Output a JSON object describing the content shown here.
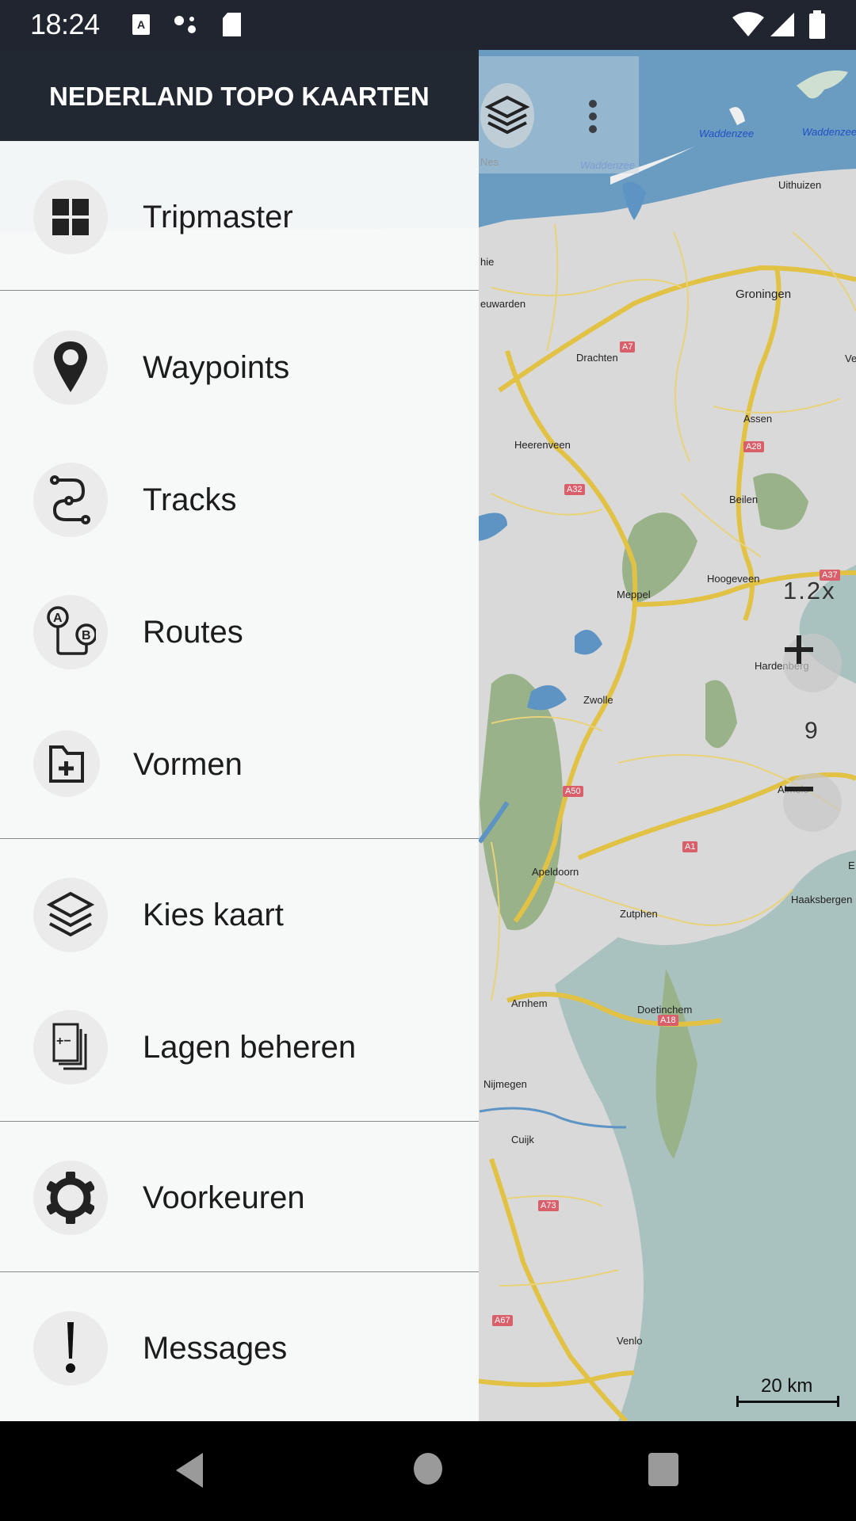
{
  "status_bar": {
    "time": "18:24",
    "left_icons": [
      "a-notification-icon",
      "assistant-dots-icon",
      "sd-card-icon"
    ],
    "right_icons": [
      "wifi-icon",
      "signal-icon",
      "battery-icon"
    ]
  },
  "drawer": {
    "title": "NEDERLAND TOPO KAARTEN",
    "items": [
      {
        "label": "Tripmaster",
        "icon": "dashboard-grid-icon"
      },
      {
        "label": "Waypoints",
        "icon": "map-pin-icon"
      },
      {
        "label": "Tracks",
        "icon": "track-path-icon"
      },
      {
        "label": "Routes",
        "icon": "route-a-b-icon"
      },
      {
        "label": "Vormen",
        "icon": "folder-plus-icon"
      },
      {
        "label": "Kies kaart",
        "icon": "layers-icon"
      },
      {
        "label": "Lagen beheren",
        "icon": "manage-layers-icon"
      },
      {
        "label": "Voorkeuren",
        "icon": "gear-icon"
      },
      {
        "label": "Messages",
        "icon": "exclamation-icon"
      }
    ]
  },
  "map": {
    "zoom_factor": "1.2x",
    "zoom_level": "9",
    "scale_label": "20 km",
    "labels": {
      "waddenzee1": "Waddenzee",
      "waddenzee2": "Waddenzee",
      "waddenzee3": "Waddenzee",
      "nes": "Nes",
      "uithuizen": "Uithuizen",
      "groningen": "Groningen",
      "leeuwarden": "euwarden",
      "hie": "hie",
      "drachten": "Drachten",
      "assen": "Assen",
      "heerenveen": "Heerenveen",
      "beilen": "Beilen",
      "hoogeveen": "Hoogeveen",
      "meppel": "Meppel",
      "hardenberg": "Hardenberg",
      "zwolle": "Zwolle",
      "almelo": "Almelo",
      "apeldoorn": "Apeldoorn",
      "zutphen": "Zutphen",
      "haaksbergen": "Haaksbergen",
      "arnhem": "Arnhem",
      "doetinchem": "Doetinchem",
      "nijmegen": "Nijmegen",
      "cuijk": "Cuijk",
      "venlo": "Venlo",
      "ve": "Ve",
      "e": "E"
    },
    "highways": {
      "a7": "A7",
      "a28": "A28",
      "a32": "A32",
      "a37": "A37",
      "a50": "A50",
      "a1": "A1",
      "a18": "A18",
      "a73": "A73",
      "a67": "A67"
    }
  },
  "colors": {
    "status_bar": "#212530",
    "drawer_header": "#222831",
    "sea": "#6a9cc2",
    "germany": "#a9c2bf",
    "forest": "#9ab28a",
    "road": "#e2c245",
    "highway_badge": "#d9606a"
  }
}
